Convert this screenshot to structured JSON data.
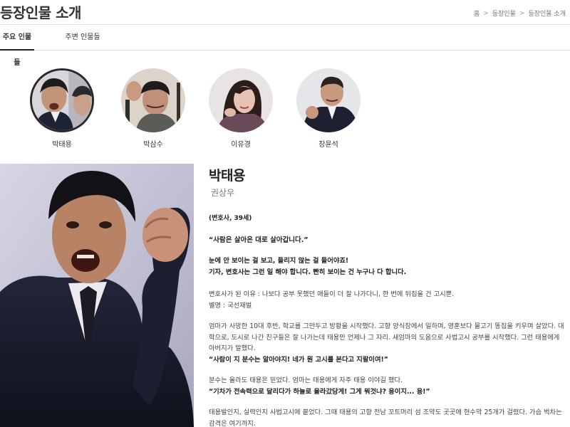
{
  "header": {
    "title": "등장인물 소개",
    "breadcrumb": [
      "홈",
      "등장인물",
      "등장인물 소개"
    ]
  },
  "tabs": [
    {
      "label": "주요 인물들",
      "active": true
    },
    {
      "label": "주변 인물들",
      "active": false
    }
  ],
  "characters": [
    {
      "name": "박태용",
      "active": true
    },
    {
      "name": "박삼수",
      "active": false
    },
    {
      "name": "이유경",
      "active": false
    },
    {
      "name": "장윤석",
      "active": false
    }
  ],
  "detail": {
    "name": "박태용",
    "actor": "권상우",
    "role": "(변호사, 39세)",
    "quote": "“사람은 살아온 대로 살아갑니다.”",
    "bold_lines": [
      "눈에 안 보이는 걸 보고, 들리지 않는 걸 들어야죠!",
      "기자, 변호사는 그런 일 해야 합니다. 빤히 보이는 건 누구나 다 합니다."
    ],
    "reason": "변호사가 된 이유 : 나보다 공부 못했던 애들이 더 잘 나가다니, 한 번에 뒤집을 건 고시뿐.",
    "nickname": "별명 : 국선재벌",
    "para1": "엄마가 사망한 10대 후반, 학교를 그만두고 방황을 시작했다. 고향 양식장에서 일하며, 영훈보다 물고기 똥집을 키우며 살았다. 대학으로, 도시로 나간 친구들은 잘 나가는데 태용만 언제나 그 자리. 새엄마의 도움으로 사법고시 공부를 시작했다. 그런 태용에게 아버지가 말했다.",
    "quote2": "“사람이 지 분수는 알아야지! 네가 뭔 고시를 본다고 지랄이여!”",
    "para2": "분수는 올라도 태용은 믿었다. 엄마는 태용에게 자주 태용 이야길 했다.",
    "quote3": "“기차가 전속력으로 달리다가 하늘로 올라갔당게! 그게 뭐것냐? 용이지... 용!”",
    "para3": "태용발인지, 실력인지 사법고시에 붙었다. 그때 태용의 고향 전남 꼬트머리 섬 조약도 곳곳에 현수막 25개가 걸렸다. 가슴 벅차는 감격은 여기까지."
  }
}
